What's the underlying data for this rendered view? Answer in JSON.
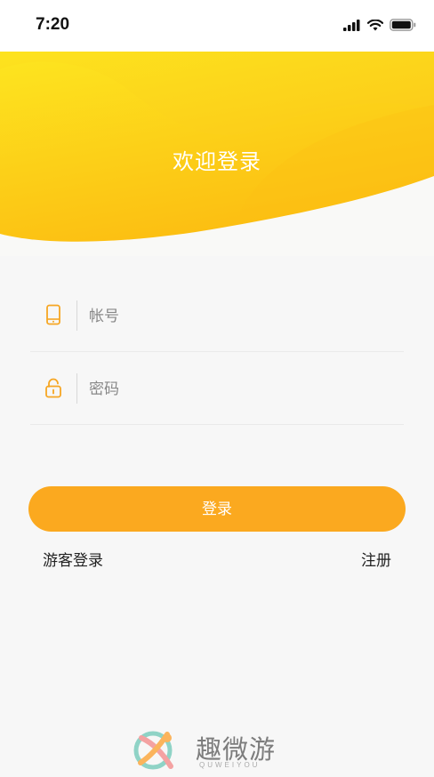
{
  "status_bar": {
    "time": "7:20"
  },
  "hero": {
    "title": "欢迎登录"
  },
  "form": {
    "account_placeholder": "帐号",
    "password_placeholder": "密码",
    "login_label": "登录"
  },
  "links": {
    "guest": "游客登录",
    "register": "注册"
  },
  "brand": {
    "name": "趣微游",
    "subtitle": "QUWEIYOU"
  },
  "colors": {
    "accent": "#fba91f",
    "hero_yellow": "#fdd41c",
    "background": "#f7f7f7"
  }
}
